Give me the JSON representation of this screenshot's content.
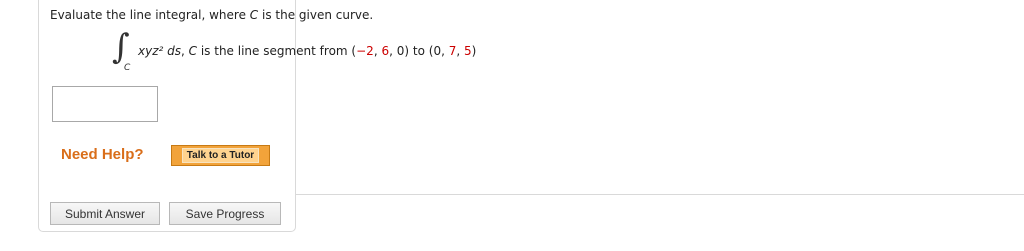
{
  "question": {
    "prompt_before": "Evaluate the line integral, where ",
    "prompt_var": "C",
    "prompt_after": " is the given curve."
  },
  "integral": {
    "sign": "∫",
    "subscript": "C",
    "integrand": "xyz² ds",
    "sep": ", ",
    "curve_var": "C",
    "desc": " is the line segment from ",
    "p1_open": "(",
    "p1": [
      "−2",
      "6",
      "0"
    ],
    "p1_close": ")",
    "to": " to ",
    "p2_open": "(",
    "p2": [
      "0",
      "7",
      "5"
    ],
    "p2_close": ")"
  },
  "answer": {
    "value": ""
  },
  "help": {
    "need_help": "Need Help?",
    "tutor_label": "Talk to a Tutor"
  },
  "actions": {
    "submit_label": "Submit Answer",
    "save_label": "Save Progress"
  },
  "colors": {
    "highlight_numbers": "#cc0000",
    "need_help": "#d96e1a",
    "tutor_button": "#f2a33a"
  }
}
